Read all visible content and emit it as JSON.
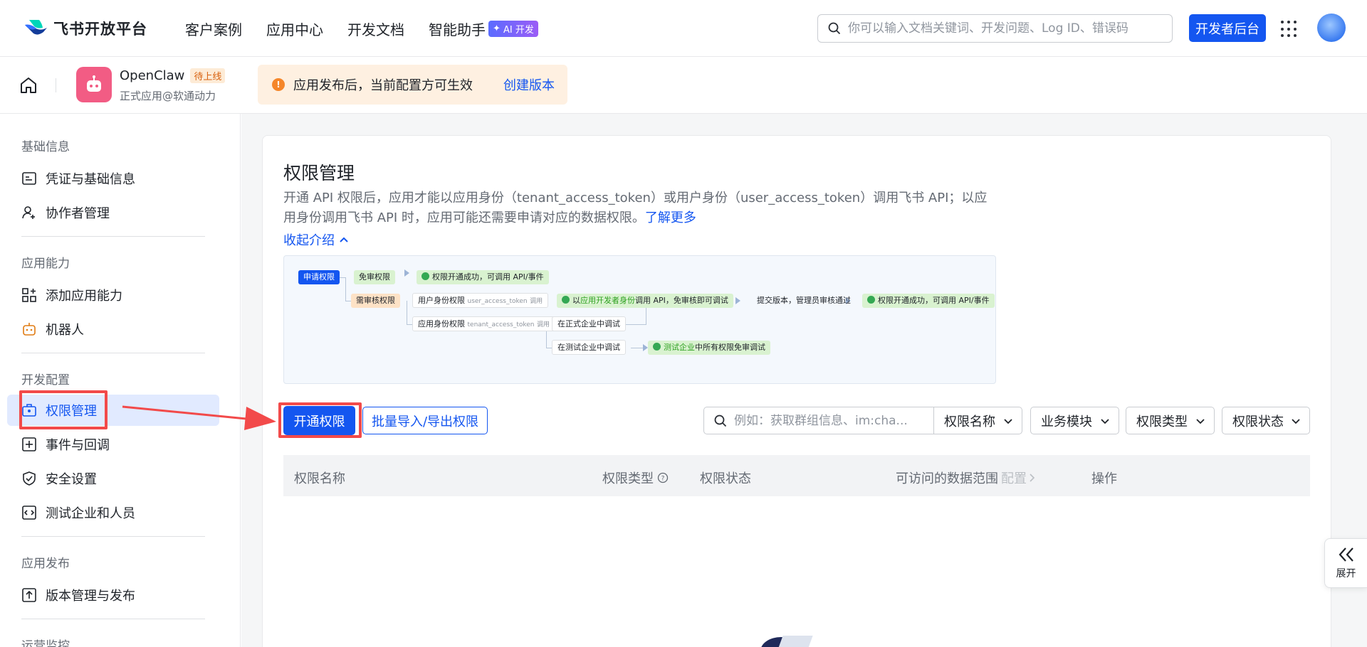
{
  "brand": {
    "name": "飞书开放平台"
  },
  "nav": {
    "links": [
      "客户案例",
      "应用中心",
      "开发文档",
      "智能助手"
    ],
    "ai_badge": "AI 开发",
    "search_placeholder": "你可以输入文档关键词、开发问题、Log ID、错误码",
    "dev_console": "开发者后台"
  },
  "app": {
    "name": "OpenClaw",
    "status": "待上线",
    "subtitle": "正式应用@软通动力",
    "notice": "应用发布后，当前配置方可生效",
    "notice_link": "创建版本"
  },
  "sidebar": {
    "groups": [
      {
        "title": "基础信息",
        "items": [
          "凭证与基础信息",
          "协作者管理"
        ]
      },
      {
        "title": "应用能力",
        "items": [
          "添加应用能力",
          "机器人"
        ]
      },
      {
        "title": "开发配置",
        "items": [
          "权限管理",
          "事件与回调",
          "安全设置",
          "测试企业和人员"
        ]
      },
      {
        "title": "应用发布",
        "items": [
          "版本管理与发布"
        ]
      },
      {
        "title": "运营监控",
        "items": []
      }
    ],
    "active_item": "权限管理"
  },
  "page": {
    "title": "权限管理",
    "desc_main": "开通 API 权限后，应用才能以应用身份（tenant_access_token）或用户身份（user_access_token）调用飞书 API；以应用身份调用飞书 API 时，应用可能还需要申请对应的数据权限。",
    "learn_more": "了解更多",
    "collapse": "收起介绍"
  },
  "diagram": {
    "apply": "申请权限",
    "no_review": "免审权限",
    "success": "权限开通成功，可调用 API/事件",
    "need_review": "需审核权限",
    "user_perm": "用户身份权限",
    "user_token": "user_access_token",
    "call": "调用",
    "as_dev_prefix": "以",
    "as_dev_hl": "应用开发者身份",
    "as_dev_suffix": "调用 API，免审核即可调试",
    "submit": "提交版本，管理员审核通过",
    "app_perm": "应用身份权限",
    "tenant_token": "tenant_access_token",
    "prod_debug": "在正式企业中调试",
    "test_debug": "在测试企业中调试",
    "test_hl": "测试企业",
    "test_suffix": "中所有权限免审调试"
  },
  "actions": {
    "open_perm": "开通权限",
    "bulk": "批量导入/导出权限",
    "filter_placeholder": "例如：获取群组信息、im:cha...",
    "filters": [
      "权限名称",
      "业务模块",
      "权限类型",
      "权限状态"
    ]
  },
  "table": {
    "headers": [
      "权限名称",
      "权限类型",
      "权限状态",
      "可访问的数据范围",
      "操作"
    ],
    "config_hint": "配置"
  },
  "float": {
    "expand": "展开"
  },
  "colors": {
    "primary": "#1456f0",
    "annotation": "#f24a4a",
    "app_icon": "#f25c84"
  }
}
